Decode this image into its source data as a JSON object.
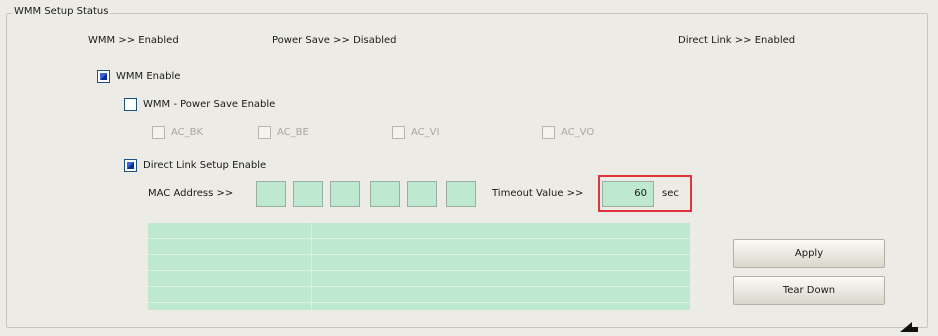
{
  "group_title": "WMM Setup Status",
  "status": {
    "wmm": "WMM >> Enabled",
    "power_save": "Power Save >> Disabled",
    "direct_link": "Direct Link >> Enabled"
  },
  "wmm_enable": {
    "label": "WMM Enable",
    "checked": true
  },
  "power_save_enable": {
    "label": "WMM - Power Save Enable",
    "checked": false
  },
  "ac_options": [
    {
      "label": "AC_BK",
      "checked": false,
      "disabled": true
    },
    {
      "label": "AC_BE",
      "checked": false,
      "disabled": true
    },
    {
      "label": "AC_VI",
      "checked": false,
      "disabled": true
    },
    {
      "label": "AC_VO",
      "checked": false,
      "disabled": true
    }
  ],
  "direct_link_enable": {
    "label": "Direct Link Setup Enable",
    "checked": true
  },
  "mac_address_label": "MAC Address >>",
  "mac_address": [
    "",
    "",
    "",
    "",
    "",
    ""
  ],
  "timeout_label": "Timeout Value >>",
  "timeout_value": "60",
  "timeout_unit": "sec",
  "buttons": {
    "apply": "Apply",
    "tear_down": "Tear Down"
  },
  "colors": {
    "field_bg": "#bfe8d0",
    "highlight": "#e0333c",
    "check_fill": "#2548c0"
  }
}
